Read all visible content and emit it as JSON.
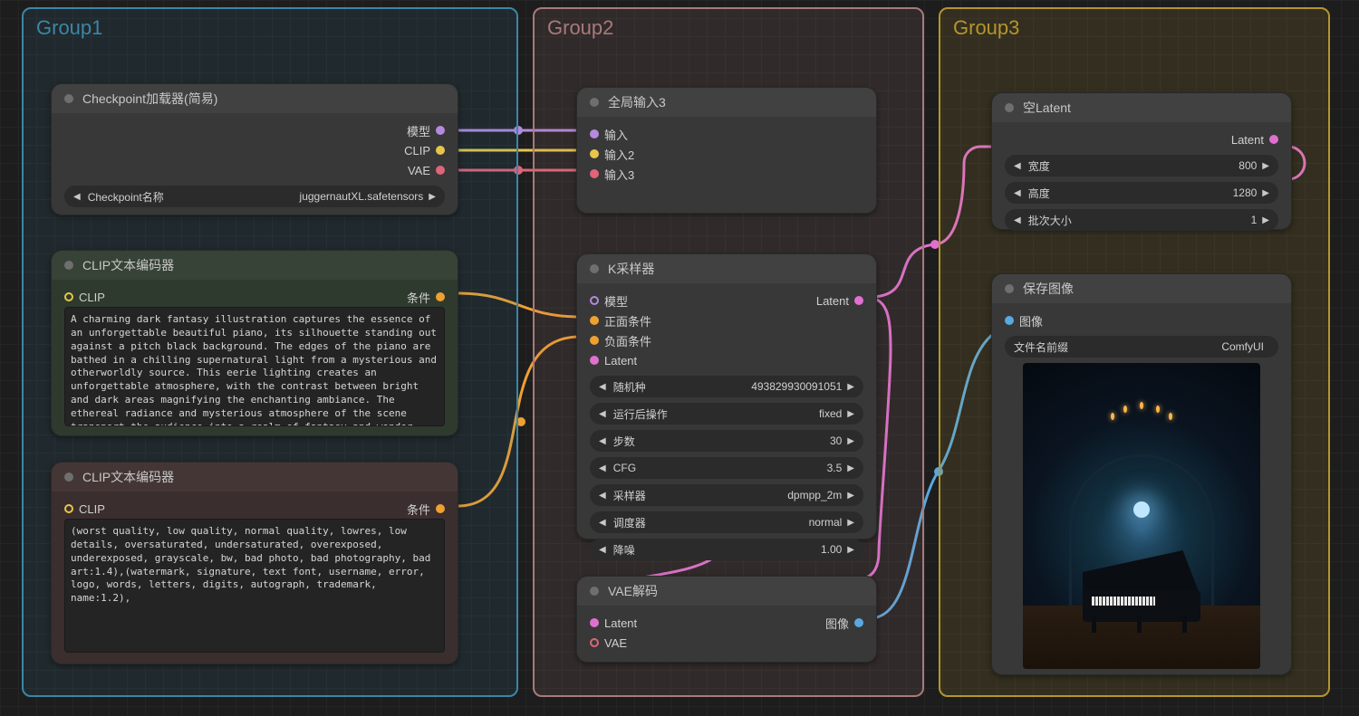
{
  "groups": {
    "g1": "Group1",
    "g2": "Group2",
    "g3": "Group3"
  },
  "checkpoint": {
    "title": "Checkpoint加载器(简易)",
    "out_model": "模型",
    "out_clip": "CLIP",
    "out_vae": "VAE",
    "field_label": "Checkpoint名称",
    "field_value": "juggernautXL.safetensors"
  },
  "clip_pos": {
    "title": "CLIP文本编码器",
    "in_clip": "CLIP",
    "out_cond": "条件",
    "text": "A charming dark fantasy illustration captures the essence of an unforgettable beautiful piano, its silhouette standing out against a pitch black background. The edges of the piano are bathed in a chilling supernatural light from a mysterious and otherworldly source. This eerie lighting creates an unforgettable atmosphere, with the contrast between bright and dark areas magnifying the enchanting ambiance. The ethereal radiance and mysterious atmosphere of the scene transport the audience into a realm of fantasy and wonder, making this enchanting illustration a true masterpiece of dark fantasy art. The intricate details and"
  },
  "clip_neg": {
    "title": "CLIP文本编码器",
    "in_clip": "CLIP",
    "out_cond": "条件",
    "text": "(worst quality, low quality, normal quality, lowres, low details, oversaturated, undersaturated, overexposed, underexposed, grayscale, bw, bad photo, bad photography, bad art:1.4),(watermark, signature, text font, username, error, logo, words, letters, digits, autograph, trademark, name:1.2),"
  },
  "reroute": {
    "title": "全局输入3",
    "in1": "输入",
    "in2": "输入2",
    "in3": "输入3"
  },
  "ksampler": {
    "title": "K采样器",
    "in_model": "模型",
    "in_pos": "正面条件",
    "in_neg": "负面条件",
    "in_latent": "Latent",
    "out_latent": "Latent",
    "seed_label": "随机种",
    "seed_value": "493829930091051",
    "after_label": "运行后操作",
    "after_value": "fixed",
    "steps_label": "步数",
    "steps_value": "30",
    "cfg_label": "CFG",
    "cfg_value": "3.5",
    "sampler_label": "采样器",
    "sampler_value": "dpmpp_2m",
    "sched_label": "调度器",
    "sched_value": "normal",
    "denoise_label": "降噪",
    "denoise_value": "1.00"
  },
  "vaedec": {
    "title": "VAE解码",
    "in_latent": "Latent",
    "in_vae": "VAE",
    "out_image": "图像"
  },
  "emptylatent": {
    "title": "空Latent",
    "out_latent": "Latent",
    "w_label": "宽度",
    "w_value": "800",
    "h_label": "高度",
    "h_value": "1280",
    "b_label": "批次大小",
    "b_value": "1"
  },
  "save": {
    "title": "保存图像",
    "in_image": "图像",
    "prefix_label": "文件名前缀",
    "prefix_value": "ComfyUI"
  },
  "colors": {
    "model": "#b48ae0",
    "clip": "#e6c64a",
    "vae": "#e0647a",
    "cond": "#f0a030",
    "latent": "#e070d0",
    "image": "#5aa8e0"
  }
}
